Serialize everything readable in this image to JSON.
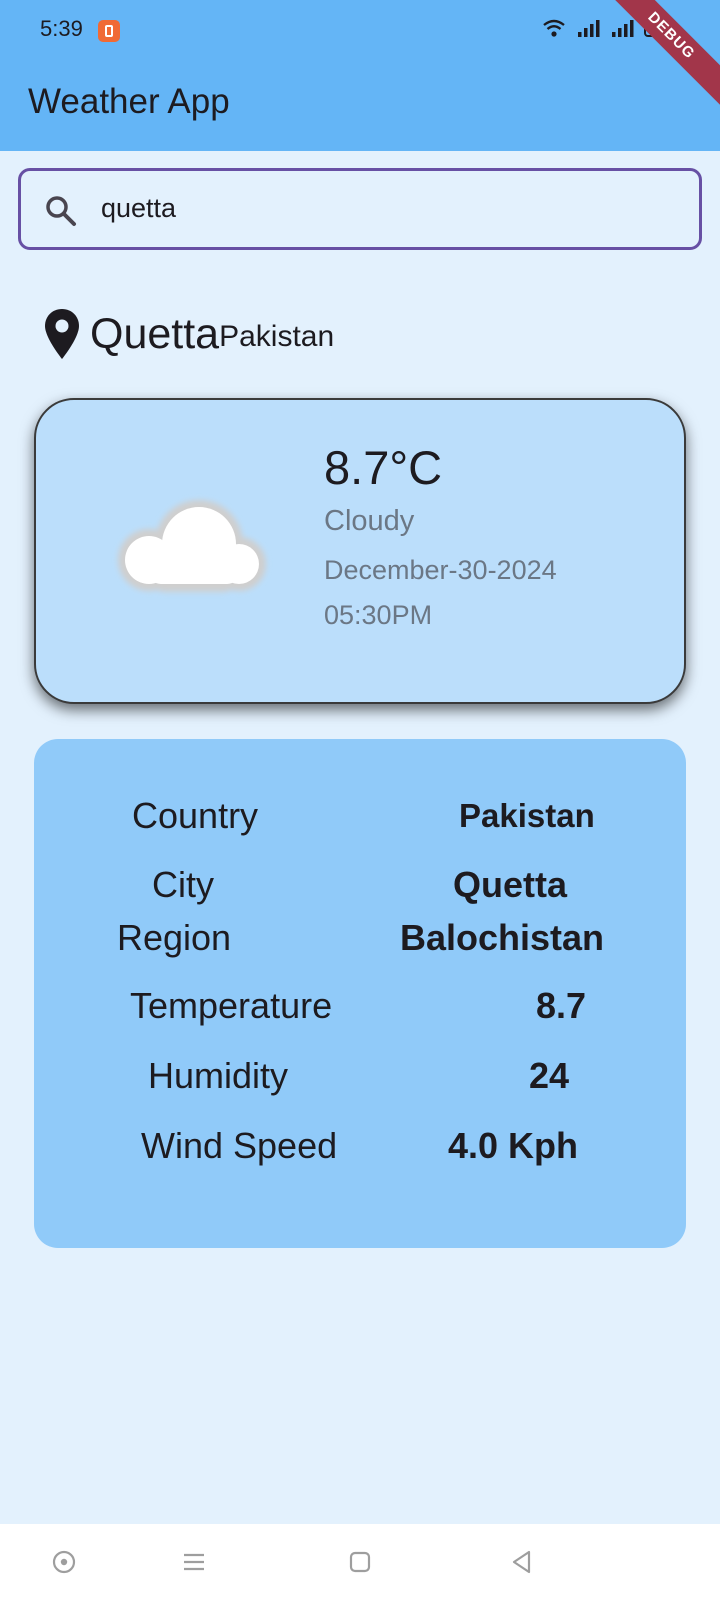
{
  "status_bar": {
    "time": "5:39",
    "debug_label": "DEBUG",
    "icons": [
      "app-notification-icon",
      "wifi-icon",
      "signal-icon",
      "signal-icon",
      "battery-icon"
    ]
  },
  "app_bar": {
    "title": "Weather App",
    "color": "#64b5f6"
  },
  "search": {
    "value": "quetta",
    "icon": "search-icon",
    "border_color": "#6750a4"
  },
  "location": {
    "city": "Quetta",
    "country": "Pakistan",
    "icon": "location-pin-icon"
  },
  "current_weather": {
    "temperature": "8.7°C",
    "condition": "Cloudy",
    "date": "December-30-2024",
    "time": "05:30PM",
    "icon": "cloud-icon",
    "card_color": "#bbdefb"
  },
  "details": {
    "card_color": "#90caf9",
    "rows": [
      {
        "label": "Country",
        "value": "Pakistan"
      },
      {
        "label": "City",
        "value": "Quetta"
      },
      {
        "label": "Region",
        "value": "Balochistan"
      },
      {
        "label": "Temperature",
        "value": "8.7"
      },
      {
        "label": "Humidity",
        "value": "24"
      },
      {
        "label": "Wind Speed",
        "value": "4.0 Kph"
      }
    ]
  },
  "nav_bar": {
    "buttons": [
      "assistant-icon",
      "menu-icon",
      "home-square-icon",
      "back-triangle-icon"
    ]
  }
}
